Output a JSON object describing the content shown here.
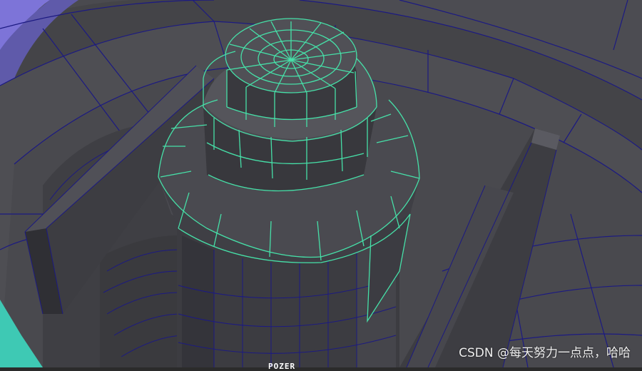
{
  "viewport": {
    "colors": {
      "background": "#2b2b2b",
      "surface": "#4e4e53",
      "surface_dark": "#3a3a3e",
      "surface_light": "#5c5c62",
      "wire": "#1c1a82",
      "selected_wire": "#46e0a8",
      "accent_purple": "#7d74d8",
      "accent_cyan": "#3ec9b4"
    },
    "hud_label": "POZER",
    "selected_object": "cylinder-stack"
  },
  "watermark": {
    "text": "CSDN @每天努力一点点，哈哈"
  }
}
